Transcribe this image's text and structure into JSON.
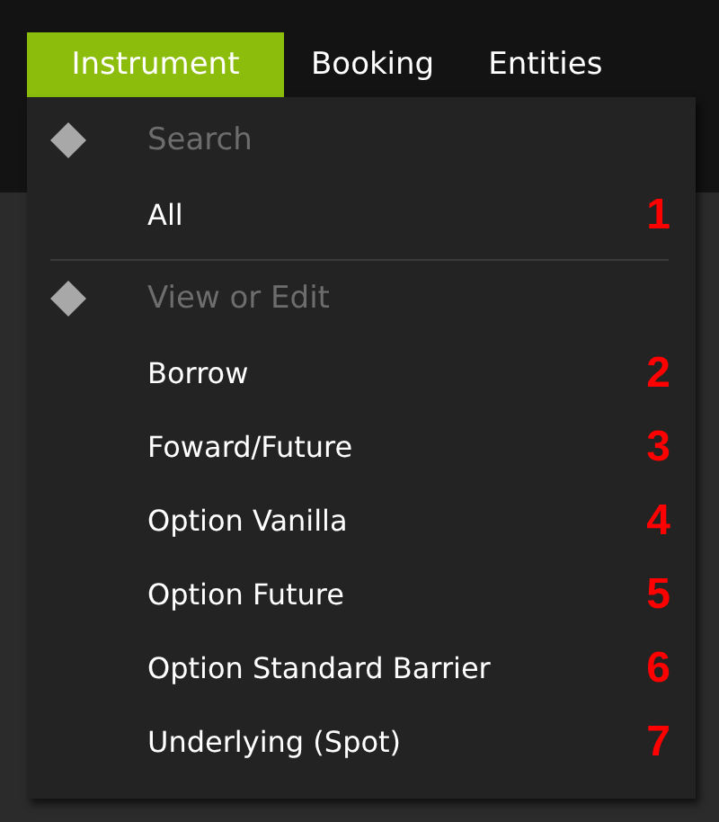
{
  "menubar": [
    {
      "label": "Instrument",
      "selected": true
    },
    {
      "label": "Booking",
      "selected": false
    },
    {
      "label": "Entities",
      "selected": false
    }
  ],
  "dropdown": {
    "sections": [
      {
        "header": "Search",
        "items": [
          {
            "label": "All",
            "annotation": "1"
          }
        ]
      },
      {
        "header": "View or Edit",
        "items": [
          {
            "label": "Borrow",
            "annotation": "2"
          },
          {
            "label": "Foward/Future",
            "annotation": "3"
          },
          {
            "label": "Option Vanilla",
            "annotation": "4"
          },
          {
            "label": "Option Future",
            "annotation": "5"
          },
          {
            "label": "Option Standard Barrier",
            "annotation": "6"
          },
          {
            "label": "Underlying (Spot)",
            "annotation": "7"
          }
        ]
      }
    ]
  }
}
